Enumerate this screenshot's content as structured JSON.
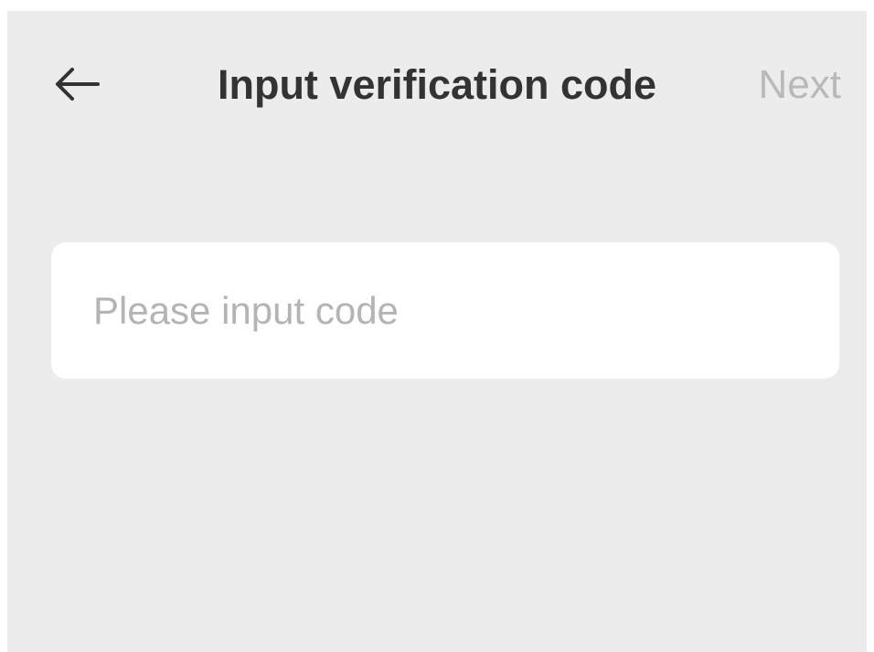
{
  "header": {
    "back_icon": "arrow-left-icon",
    "title": "Input verification code",
    "next_label": "Next"
  },
  "form": {
    "code_value": "",
    "code_placeholder": "Please input code"
  },
  "colors": {
    "background": "#ececec",
    "card": "#ffffff",
    "title_text": "#333333",
    "next_disabled": "#b9b9b9",
    "placeholder": "#b4b4b4"
  }
}
